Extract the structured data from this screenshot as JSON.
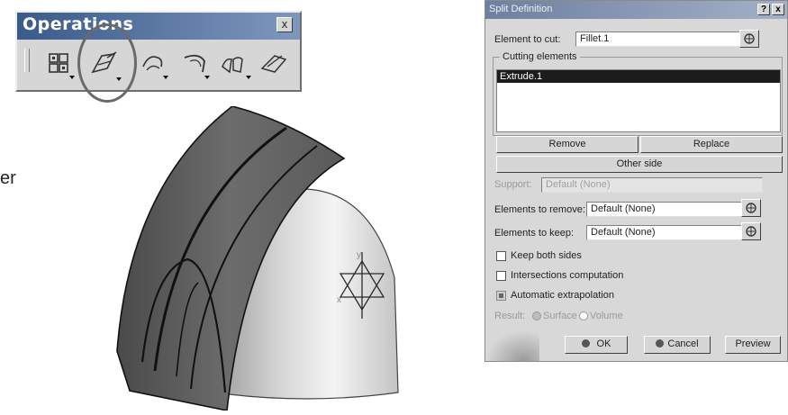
{
  "toolbar": {
    "title": "Operations",
    "close_label": "x",
    "icons": [
      "join-icon",
      "split-icon",
      "trim-icon",
      "fillet-icon",
      "translate-icon",
      "extract-icon"
    ]
  },
  "side_text": "er",
  "model": {
    "axis_x": "x",
    "axis_y": "y"
  },
  "dialog": {
    "title": "Split Definition",
    "help_label": "?",
    "close_label": "x",
    "element_to_cut_label": "Element to cut:",
    "element_to_cut_value": "Fillet.1",
    "cutting_elements_label": "Cutting elements",
    "cutting_elements": [
      "Extrude.1"
    ],
    "remove_label": "Remove",
    "replace_label": "Replace",
    "other_side_label": "Other side",
    "support_label": "Support:",
    "support_value": "Default (None)",
    "elements_to_remove_label": "Elements to remove:",
    "elements_to_remove_value": "Default (None)",
    "elements_to_keep_label": "Elements to keep:",
    "elements_to_keep_value": "Default (None)",
    "keep_both_sides_label": "Keep both sides",
    "intersections_label": "Intersections computation",
    "auto_extrapolation_label": "Automatic extrapolation",
    "result_label": "Result:",
    "surface_label": "Surface",
    "volume_label": "Volume",
    "ok_label": "OK",
    "cancel_label": "Cancel",
    "preview_label": "Preview"
  }
}
